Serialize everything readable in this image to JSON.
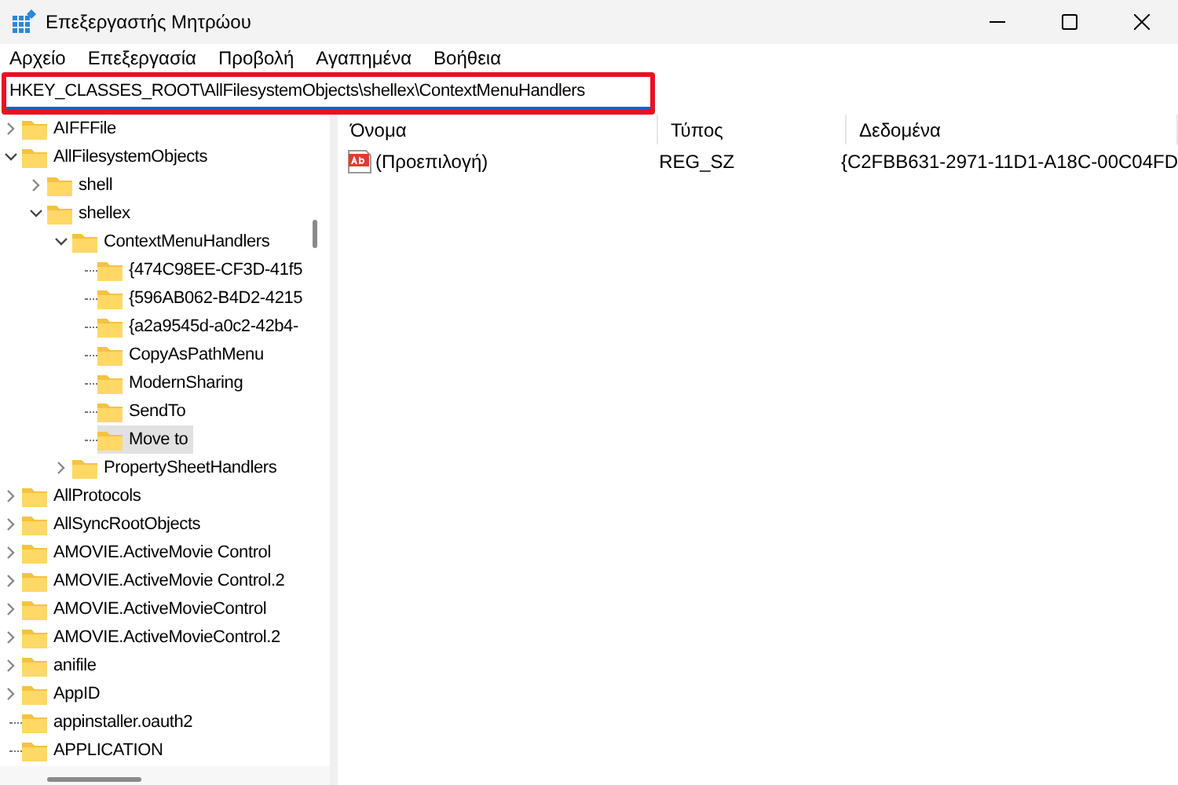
{
  "window": {
    "title": "Επεξεργαστής Μητρώου"
  },
  "menu": [
    "Αρχείο",
    "Επεξεργασία",
    "Προβολή",
    "Αγαπημένα",
    "Βοήθεια"
  ],
  "address": {
    "value": "HKEY_CLASSES_ROOT\\AllFilesystemObjects\\shellex\\ContextMenuHandlers"
  },
  "tree": [
    {
      "label": "AIFFFile",
      "kind": "branch",
      "expanded": false,
      "selected": false
    },
    {
      "label": "AllFilesystemObjects",
      "kind": "branch",
      "expanded": true,
      "selected": false,
      "children": [
        {
          "label": "shell",
          "kind": "branch",
          "expanded": false,
          "selected": false
        },
        {
          "label": "shellex",
          "kind": "branch",
          "expanded": true,
          "selected": false,
          "children": [
            {
              "label": "ContextMenuHandlers",
              "kind": "branch",
              "expanded": true,
              "selected": false,
              "children": [
                {
                  "label": "{474C98EE-CF3D-41f5",
                  "kind": "leaf",
                  "selected": false
                },
                {
                  "label": "{596AB062-B4D2-4215",
                  "kind": "leaf",
                  "selected": false
                },
                {
                  "label": "{a2a9545d-a0c2-42b4-",
                  "kind": "leaf",
                  "selected": false
                },
                {
                  "label": "CopyAsPathMenu",
                  "kind": "leaf",
                  "selected": false
                },
                {
                  "label": "ModernSharing",
                  "kind": "leaf",
                  "selected": false
                },
                {
                  "label": "SendTo",
                  "kind": "leaf",
                  "selected": false
                },
                {
                  "label": "Move to",
                  "kind": "leaf",
                  "selected": true
                }
              ]
            },
            {
              "label": "PropertySheetHandlers",
              "kind": "branch",
              "expanded": false,
              "selected": false
            }
          ]
        }
      ]
    },
    {
      "label": "AllProtocols",
      "kind": "branch",
      "expanded": false,
      "selected": false
    },
    {
      "label": "AllSyncRootObjects",
      "kind": "branch",
      "expanded": false,
      "selected": false
    },
    {
      "label": "AMOVIE.ActiveMovie Control",
      "kind": "branch",
      "expanded": false,
      "selected": false
    },
    {
      "label": "AMOVIE.ActiveMovie Control.2",
      "kind": "branch",
      "expanded": false,
      "selected": false
    },
    {
      "label": "AMOVIE.ActiveMovieControl",
      "kind": "branch",
      "expanded": false,
      "selected": false
    },
    {
      "label": "AMOVIE.ActiveMovieControl.2",
      "kind": "branch",
      "expanded": false,
      "selected": false
    },
    {
      "label": "anifile",
      "kind": "branch",
      "expanded": false,
      "selected": false
    },
    {
      "label": "AppID",
      "kind": "branch",
      "expanded": false,
      "selected": false
    },
    {
      "label": "appinstaller.oauth2",
      "kind": "leaf",
      "selected": false
    },
    {
      "label": "APPLICATION",
      "kind": "leaf",
      "selected": false
    }
  ],
  "table": {
    "columns": [
      "Όνομα",
      "Τύπος",
      "Δεδομένα"
    ],
    "rows": [
      {
        "name": "(Προεπιλογή)",
        "type": "REG_SZ",
        "data": "{C2FBB631-2971-11D1-A18C-00C04FD"
      }
    ]
  }
}
